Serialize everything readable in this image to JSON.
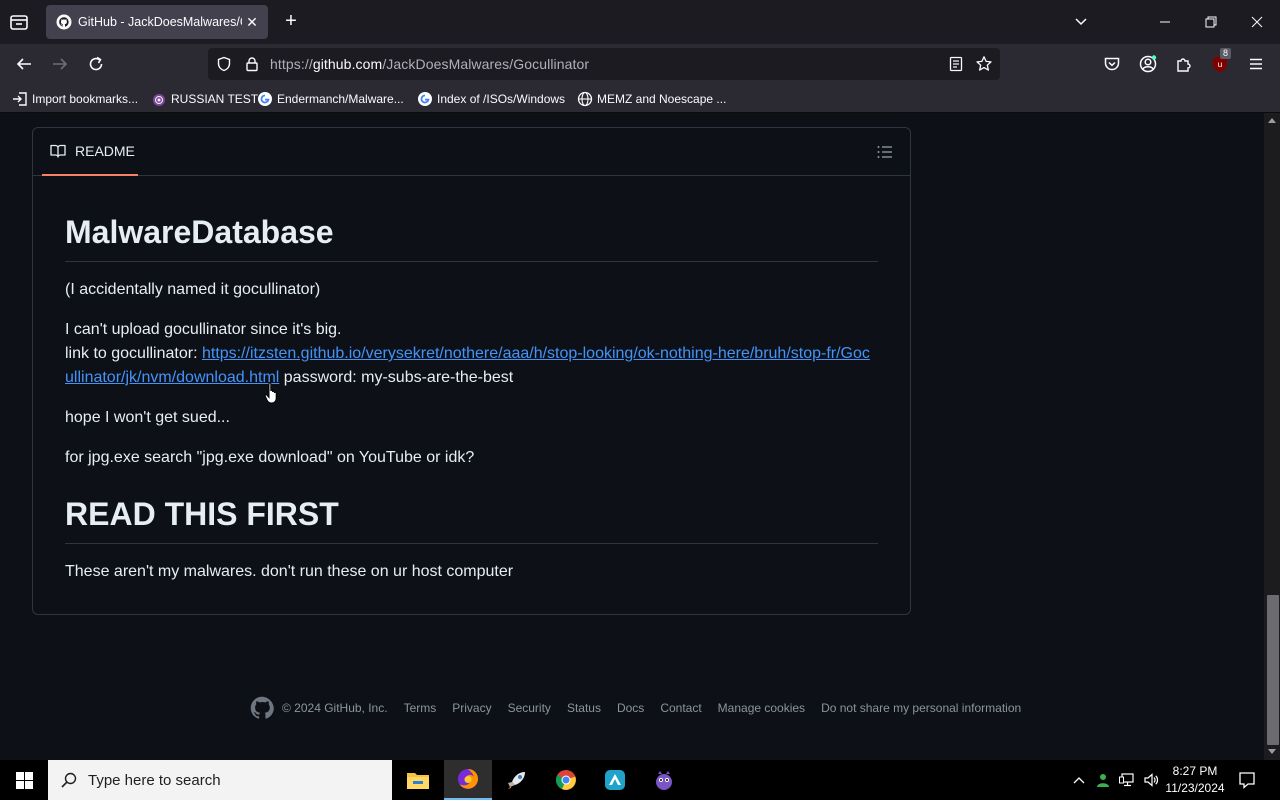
{
  "browser": {
    "tab_title": "GitHub - JackDoesMalwares/Gocullinator",
    "url_prefix": "https://",
    "url_host": "github.com",
    "url_path": "/JackDoesMalwares/Gocullinator",
    "extension_badge": "8",
    "bookmarks": [
      {
        "label": "Import bookmarks...",
        "icon": "import-icon"
      },
      {
        "label": "RUSSIAN TEST",
        "icon": "tor-icon"
      },
      {
        "label": "Endermanch/Malware...",
        "icon": "google-icon"
      },
      {
        "label": "Index of /ISOs/Windows",
        "icon": "google-icon"
      },
      {
        "label": "MEMZ and Noescape ...",
        "icon": "globe-icon"
      }
    ]
  },
  "readme": {
    "tab_label": "README",
    "heading1": "MalwareDatabase",
    "p1": "(I accidentally named it gocullinator)",
    "p2_line1": "I can't upload gocullinator since it's big.",
    "p2_line2_prefix": "link to gocullinator: ",
    "p2_link": "https://itzsten.github.io/verysekret/nothere/aaa/h/stop-looking/ok-nothing-here/bruh/stop-fr/Gocullinator/jk/nvm/download.html",
    "p2_suffix": " password: my-subs-are-the-best",
    "p3": "hope I won't get sued...",
    "p4": "for jpg.exe search \"jpg.exe download\" on YouTube or idk?",
    "heading2": "READ THIS FIRST",
    "p5": "These aren't my malwares. don't run these on ur host computer"
  },
  "footer": {
    "copyright": "© 2024 GitHub, Inc.",
    "links": [
      "Terms",
      "Privacy",
      "Security",
      "Status",
      "Docs",
      "Contact",
      "Manage cookies",
      "Do not share my personal information"
    ]
  },
  "taskbar": {
    "search_placeholder": "Type here to search",
    "time": "8:27 PM",
    "date": "11/23/2024"
  },
  "colors": {
    "page_bg": "#0d1117",
    "link": "#4493f8",
    "tab_underline": "#f78166",
    "border": "#30363d"
  }
}
